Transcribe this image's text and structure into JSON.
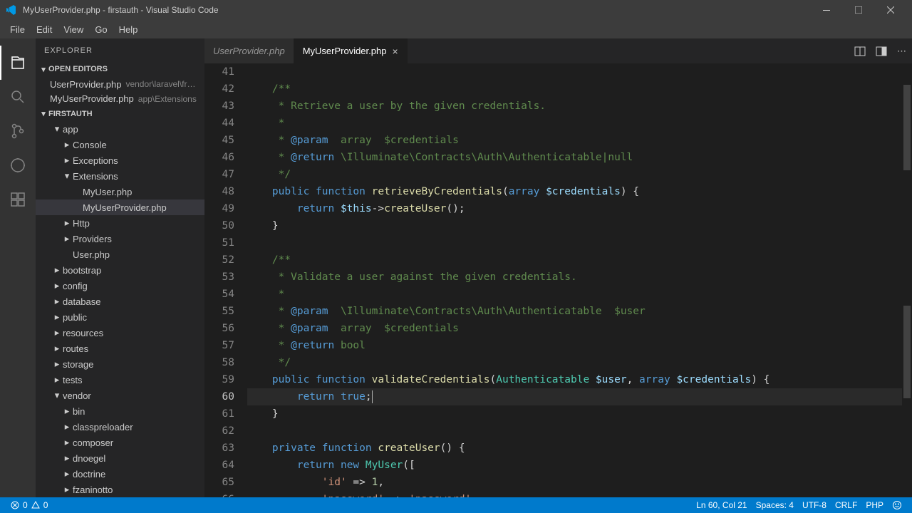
{
  "window": {
    "title": "MyUserProvider.php - firstauth - Visual Studio Code"
  },
  "menu": [
    "File",
    "Edit",
    "View",
    "Go",
    "Help"
  ],
  "explorer": {
    "title": "EXPLORER",
    "openEditorsLabel": "OPEN EDITORS",
    "openEditors": [
      {
        "name": "UserProvider.php",
        "hint": "vendor\\laravel\\fra..."
      },
      {
        "name": "MyUserProvider.php",
        "hint": "app\\Extensions"
      }
    ],
    "workspaceLabel": "FIRSTAUTH",
    "tree": [
      {
        "label": "app",
        "indent": 1,
        "chev": "down"
      },
      {
        "label": "Console",
        "indent": 2,
        "chev": "right"
      },
      {
        "label": "Exceptions",
        "indent": 2,
        "chev": "right"
      },
      {
        "label": "Extensions",
        "indent": 2,
        "chev": "down"
      },
      {
        "label": "MyUser.php",
        "indent": 3,
        "file": true
      },
      {
        "label": "MyUserProvider.php",
        "indent": 3,
        "file": true,
        "selected": true
      },
      {
        "label": "Http",
        "indent": 2,
        "chev": "right"
      },
      {
        "label": "Providers",
        "indent": 2,
        "chev": "right"
      },
      {
        "label": "User.php",
        "indent": 2,
        "file": true
      },
      {
        "label": "bootstrap",
        "indent": 1,
        "chev": "right"
      },
      {
        "label": "config",
        "indent": 1,
        "chev": "right"
      },
      {
        "label": "database",
        "indent": 1,
        "chev": "right"
      },
      {
        "label": "public",
        "indent": 1,
        "chev": "right"
      },
      {
        "label": "resources",
        "indent": 1,
        "chev": "right"
      },
      {
        "label": "routes",
        "indent": 1,
        "chev": "right"
      },
      {
        "label": "storage",
        "indent": 1,
        "chev": "right"
      },
      {
        "label": "tests",
        "indent": 1,
        "chev": "right"
      },
      {
        "label": "vendor",
        "indent": 1,
        "chev": "down"
      },
      {
        "label": "bin",
        "indent": 2,
        "chev": "right"
      },
      {
        "label": "classpreloader",
        "indent": 2,
        "chev": "right"
      },
      {
        "label": "composer",
        "indent": 2,
        "chev": "right"
      },
      {
        "label": "dnoegel",
        "indent": 2,
        "chev": "right"
      },
      {
        "label": "doctrine",
        "indent": 2,
        "chev": "right"
      },
      {
        "label": "fzaninotto",
        "indent": 2,
        "chev": "right"
      }
    ]
  },
  "tabs": [
    {
      "label": "UserProvider.php",
      "active": false
    },
    {
      "label": "MyUserProvider.php",
      "active": true
    }
  ],
  "editor": {
    "startLine": 41,
    "activeLine": 60
  },
  "status": {
    "errors": "0",
    "warnings": "0",
    "cursor": "Ln 60, Col 21",
    "spaces": "Spaces: 4",
    "encoding": "UTF-8",
    "eol": "CRLF",
    "language": "PHP"
  }
}
